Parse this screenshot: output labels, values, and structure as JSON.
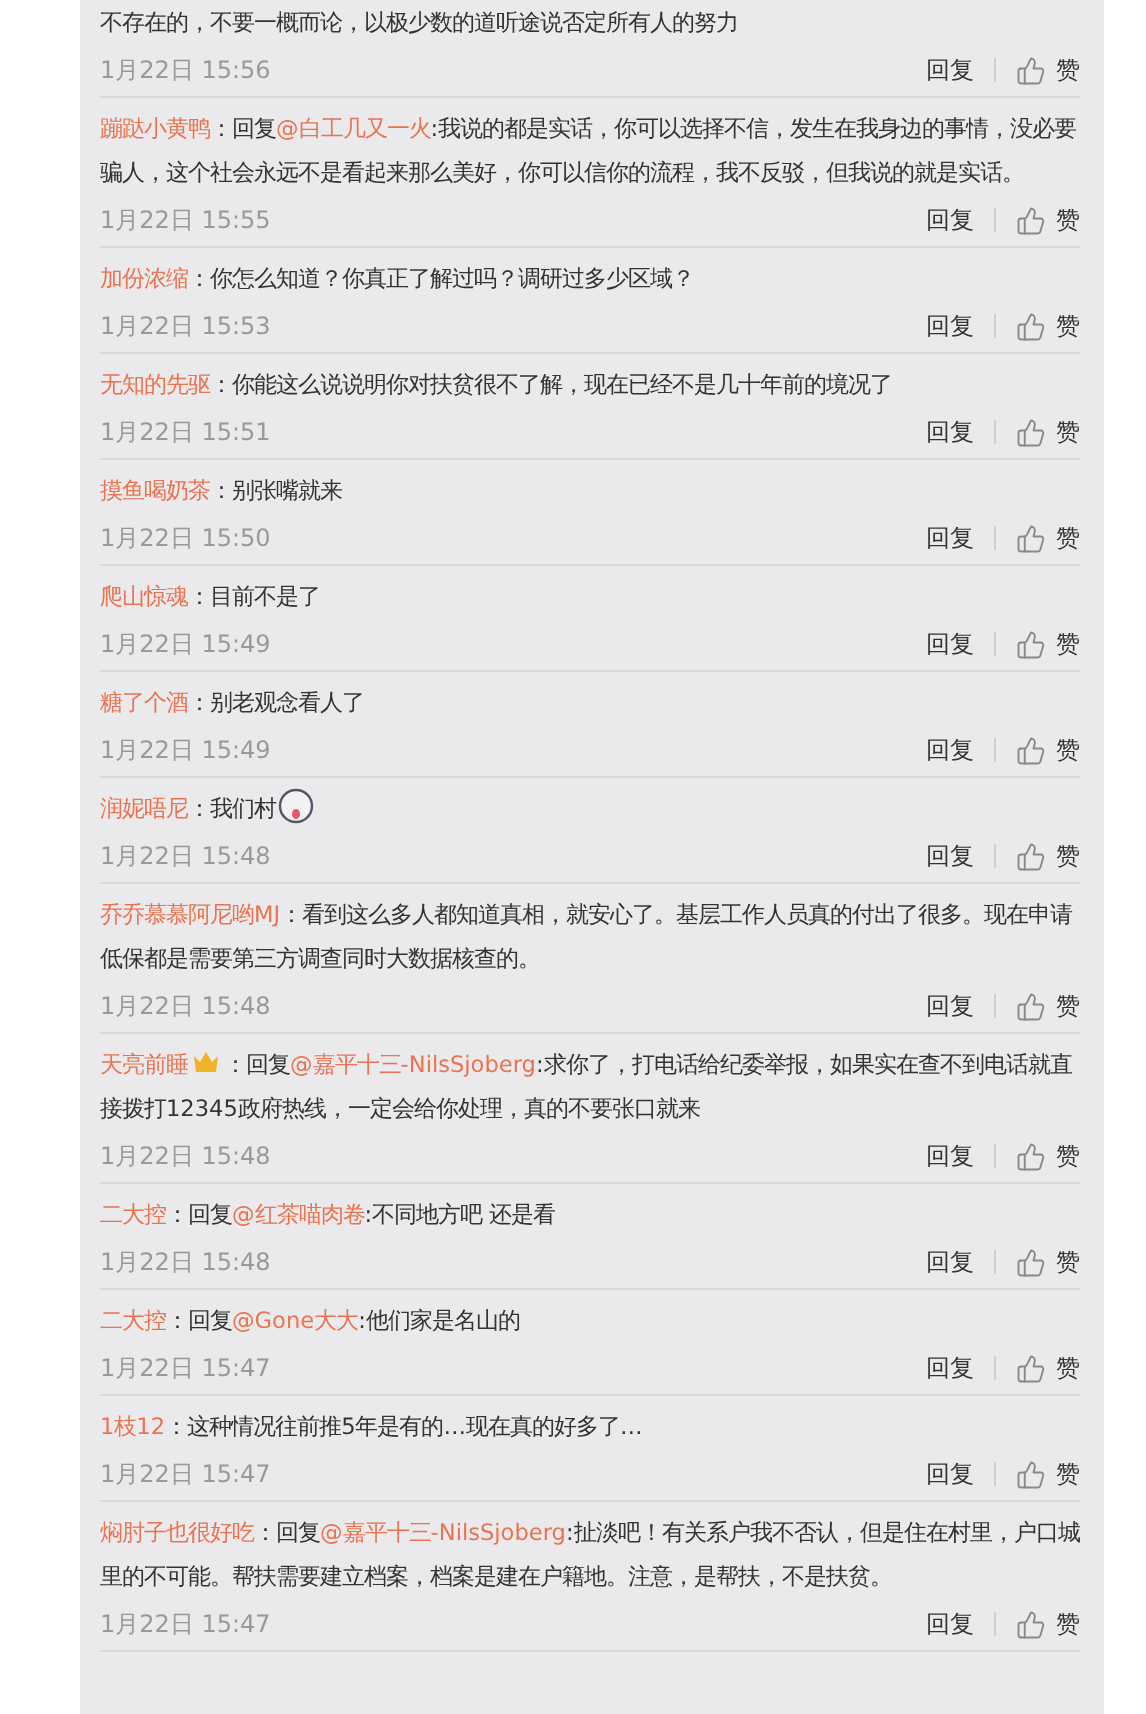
{
  "comments": [
    {
      "parts": [
        {
          "kind": "plain",
          "text": "不存在的，不要一概而论，以极少数的道听途说否定所有人的努力"
        }
      ],
      "time": "1月22日 15:56",
      "reply_label": "回复",
      "like_label": "赞"
    },
    {
      "parts": [
        {
          "kind": "user",
          "text": "蹦跶小黄鸭"
        },
        {
          "kind": "plain",
          "text": "：回复"
        },
        {
          "kind": "mention",
          "text": "@白工几又一火"
        },
        {
          "kind": "plain",
          "text": ":我说的都是实话，你可以选择不信，发生在我身边的事情，没必要骗人，这个社会永远不是看起来那么美好，你可以信你的流程，我不反驳，但我说的就是实话。"
        }
      ],
      "time": "1月22日 15:55",
      "reply_label": "回复",
      "like_label": "赞"
    },
    {
      "parts": [
        {
          "kind": "user",
          "text": "加份浓缩"
        },
        {
          "kind": "plain",
          "text": "：你怎么知道？你真正了解过吗？调研过多少区域？"
        }
      ],
      "time": "1月22日 15:53",
      "reply_label": "回复",
      "like_label": "赞"
    },
    {
      "parts": [
        {
          "kind": "user",
          "text": "无知的先驱"
        },
        {
          "kind": "plain",
          "text": "：你能这么说说明你对扶贫很不了解，现在已经不是几十年前的境况了"
        }
      ],
      "time": "1月22日 15:51",
      "reply_label": "回复",
      "like_label": "赞"
    },
    {
      "parts": [
        {
          "kind": "user",
          "text": "摸鱼喝奶茶"
        },
        {
          "kind": "plain",
          "text": "：别张嘴就来"
        }
      ],
      "time": "1月22日 15:50",
      "reply_label": "回复",
      "like_label": "赞"
    },
    {
      "parts": [
        {
          "kind": "user",
          "text": "爬山惊魂"
        },
        {
          "kind": "plain",
          "text": "：目前不是了"
        }
      ],
      "time": "1月22日 15:49",
      "reply_label": "回复",
      "like_label": "赞"
    },
    {
      "parts": [
        {
          "kind": "user",
          "text": "糖了个酒"
        },
        {
          "kind": "plain",
          "text": "：别老观念看人了"
        }
      ],
      "time": "1月22日 15:49",
      "reply_label": "回复",
      "like_label": "赞"
    },
    {
      "parts": [
        {
          "kind": "user",
          "text": "润妮唔尼"
        },
        {
          "kind": "plain",
          "text": "：我们村"
        },
        {
          "kind": "emoji"
        }
      ],
      "time": "1月22日 15:48",
      "reply_label": "回复",
      "like_label": "赞"
    },
    {
      "parts": [
        {
          "kind": "user",
          "text": "乔乔慕慕阿尼哟MJ"
        },
        {
          "kind": "plain",
          "text": "：看到这么多人都知道真相，就安心了。基层工作人员真的付出了很多。现在申请低保都是需要第三方调查同时大数据核查的。"
        }
      ],
      "time": "1月22日 15:48",
      "reply_label": "回复",
      "like_label": "赞"
    },
    {
      "parts": [
        {
          "kind": "user",
          "text": "天亮前睡"
        },
        {
          "kind": "badge"
        },
        {
          "kind": "plain",
          "text": "：回复"
        },
        {
          "kind": "mention",
          "text": "@嘉平十三-NilsSjoberg"
        },
        {
          "kind": "plain",
          "text": ":求你了，打电话给纪委举报，如果实在查不到电话就直接拨打12345政府热线，一定会给你处理，真的不要张口就来"
        }
      ],
      "time": "1月22日 15:48",
      "reply_label": "回复",
      "like_label": "赞"
    },
    {
      "parts": [
        {
          "kind": "user",
          "text": "二大控"
        },
        {
          "kind": "plain",
          "text": "：回复"
        },
        {
          "kind": "mention",
          "text": "@红茶喵肉卷"
        },
        {
          "kind": "plain",
          "text": ":不同地方吧 还是看"
        }
      ],
      "time": "1月22日 15:48",
      "reply_label": "回复",
      "like_label": "赞"
    },
    {
      "parts": [
        {
          "kind": "user",
          "text": "二大控"
        },
        {
          "kind": "plain",
          "text": "：回复"
        },
        {
          "kind": "mention",
          "text": "@Gone大大"
        },
        {
          "kind": "plain",
          "text": ":他们家是名山的"
        }
      ],
      "time": "1月22日 15:47",
      "reply_label": "回复",
      "like_label": "赞"
    },
    {
      "parts": [
        {
          "kind": "user",
          "text": "1枝12"
        },
        {
          "kind": "plain",
          "text": "：这种情况往前推5年是有的…现在真的好多了…"
        }
      ],
      "time": "1月22日 15:47",
      "reply_label": "回复",
      "like_label": "赞"
    },
    {
      "parts": [
        {
          "kind": "user",
          "text": "焖肘子也很好吃"
        },
        {
          "kind": "plain",
          "text": "：回复"
        },
        {
          "kind": "mention",
          "text": "@嘉平十三-NilsSjoberg"
        },
        {
          "kind": "plain",
          "text": ":扯淡吧！有关系户我不否认，但是住在村里，户口城里的不可能。帮扶需要建立档案，档案是建在户籍地。注意，是帮扶，不是扶贫。"
        }
      ],
      "time": "1月22日 15:47",
      "reply_label": "回复",
      "like_label": "赞"
    }
  ]
}
